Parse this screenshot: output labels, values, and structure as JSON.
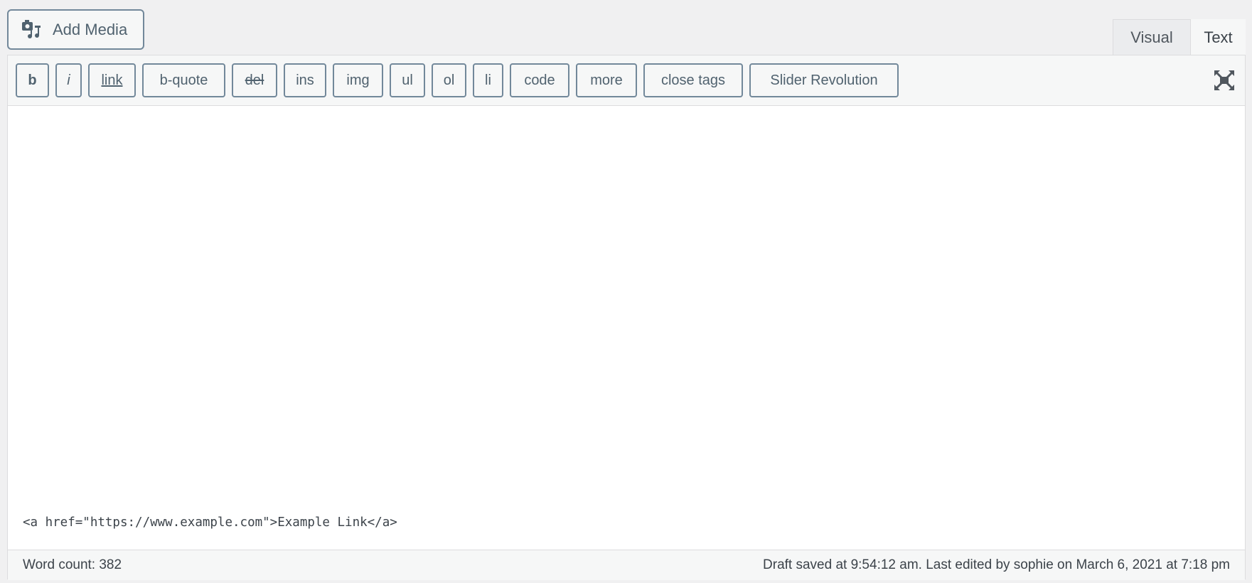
{
  "header": {
    "add_media_label": "Add Media",
    "add_media_icon": "media-icon"
  },
  "tabs": [
    {
      "label": "Visual",
      "active": false
    },
    {
      "label": "Text",
      "active": true
    }
  ],
  "toolbar": {
    "buttons": [
      "b",
      "i",
      "link",
      "b-quote",
      "del",
      "ins",
      "img",
      "ul",
      "ol",
      "li",
      "code",
      "more",
      "close tags",
      "Slider Revolution"
    ],
    "fullscreen_icon": "fullscreen-icon"
  },
  "editor": {
    "content": "<a href=\"https://www.example.com\">Example Link</a>"
  },
  "footer": {
    "word_count": "Word count: 382",
    "status": "Draft saved at 9:54:12 am. Last edited by sophie on March 6, 2021 at 7:18 pm"
  },
  "colors": {
    "button_border": "#72889a",
    "button_text": "#50626f",
    "background": "#f0f0f1"
  }
}
